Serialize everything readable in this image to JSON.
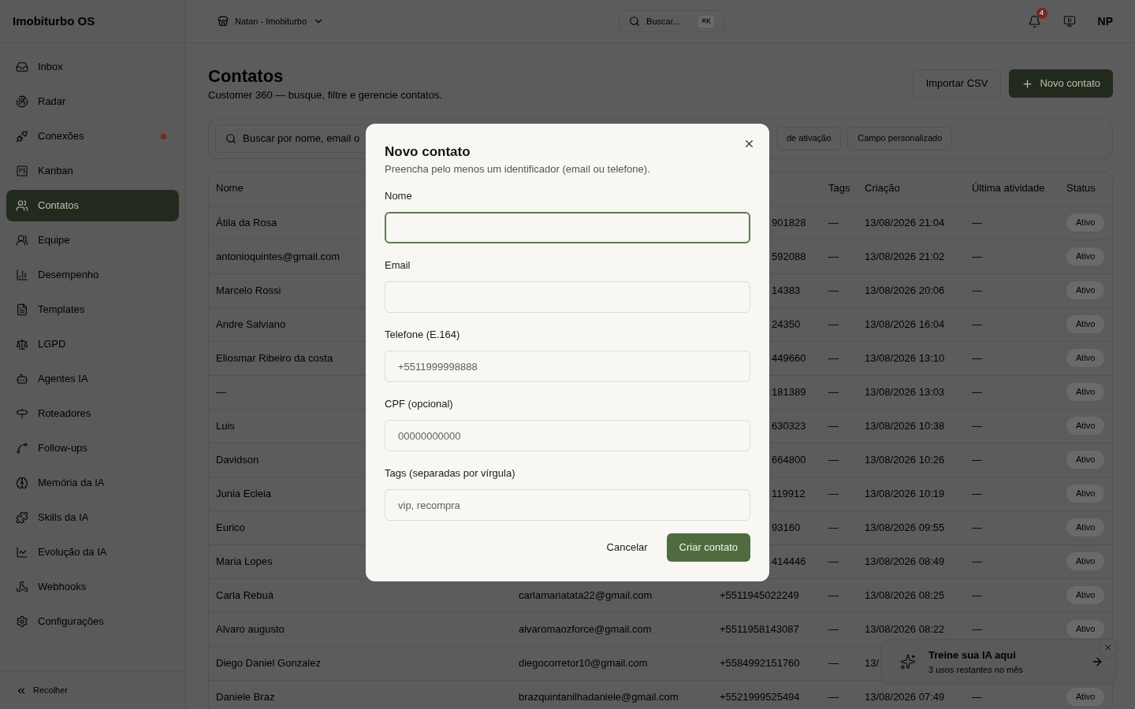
{
  "app": {
    "name": "Imobiturbo OS"
  },
  "workspace": {
    "label": "Natan - Imobiturbo"
  },
  "top_search": {
    "placeholder": "Buscar...",
    "shortcut": "⌘K"
  },
  "notifications": {
    "count": "4"
  },
  "user": {
    "initials": "NP"
  },
  "sidebar": {
    "items": [
      {
        "label": "Inbox",
        "selected": false,
        "alert": false
      },
      {
        "label": "Radar",
        "selected": false,
        "alert": false
      },
      {
        "label": "Conexões",
        "selected": false,
        "alert": true
      },
      {
        "label": "Kanban",
        "selected": false,
        "alert": false
      },
      {
        "label": "Contatos",
        "selected": true,
        "alert": false
      },
      {
        "label": "Equipe",
        "selected": false,
        "alert": false
      },
      {
        "label": "Desempenho",
        "selected": false,
        "alert": false
      },
      {
        "label": "Templates",
        "selected": false,
        "alert": false
      },
      {
        "label": "LGPD",
        "selected": false,
        "alert": false
      },
      {
        "label": "Agentes IA",
        "selected": false,
        "alert": false
      },
      {
        "label": "Roteadores",
        "selected": false,
        "alert": false
      },
      {
        "label": "Follow-ups",
        "selected": false,
        "alert": false
      },
      {
        "label": "Memória da IA",
        "selected": false,
        "alert": false
      },
      {
        "label": "Skills da IA",
        "selected": false,
        "alert": false
      },
      {
        "label": "Evolução da IA",
        "selected": false,
        "alert": false
      },
      {
        "label": "Webhooks",
        "selected": false,
        "alert": false
      },
      {
        "label": "Configurações",
        "selected": false,
        "alert": false
      }
    ],
    "collapse": "Recolher"
  },
  "page": {
    "title": "Contatos",
    "subtitle": "Customer 360 — busque, filtre e gerencie contatos.",
    "buttons": {
      "import": "Importar CSV",
      "new": "Novo contato"
    }
  },
  "filters": {
    "search_placeholder": "Buscar por nome, email o",
    "chips": [
      "de ativação",
      "Campo personalizado"
    ]
  },
  "table": {
    "header": {
      "name": "Nome",
      "tags": "Tags",
      "created": "Criação",
      "last_activity": "Última atividade",
      "status": "Status"
    },
    "rows": [
      {
        "name": "Átila da Rosa",
        "phone": "901828",
        "phone_cut": true,
        "tags": "—",
        "created": "13/08/2026 21:04",
        "last_activity": "—",
        "status": "Ativo"
      },
      {
        "name": "antonioquintes@gmail.com",
        "phone": "592088",
        "phone_cut": true,
        "tags": "—",
        "created": "13/08/2026 21:02",
        "last_activity": "—",
        "status": "Ativo"
      },
      {
        "name": "Marcelo Rossi",
        "phone": "14383",
        "phone_cut": true,
        "tags": "—",
        "created": "13/08/2026 20:06",
        "last_activity": "—",
        "status": "Ativo"
      },
      {
        "name": "Andre Salviano",
        "phone": "24350",
        "phone_cut": true,
        "tags": "—",
        "created": "13/08/2026 16:04",
        "last_activity": "—",
        "status": "Ativo"
      },
      {
        "name": "Eliosmar Ribeiro da costa",
        "phone": "449660",
        "phone_cut": true,
        "tags": "—",
        "created": "13/08/2026 13:10",
        "last_activity": "—",
        "status": "Ativo"
      },
      {
        "name": "—",
        "phone": "181389",
        "phone_cut": true,
        "tags": "—",
        "created": "13/08/2026 13:03",
        "last_activity": "—",
        "status": "Ativo"
      },
      {
        "name": "Luis",
        "phone": "630323",
        "phone_cut": true,
        "tags": "—",
        "created": "13/08/2026 10:38",
        "last_activity": "—",
        "status": "Ativo"
      },
      {
        "name": "Davidson",
        "phone": "664800",
        "phone_cut": true,
        "tags": "—",
        "created": "13/08/2026 10:26",
        "last_activity": "—",
        "status": "Ativo"
      },
      {
        "name": "Junia Ecleia",
        "phone": "119912",
        "phone_cut": true,
        "tags": "—",
        "created": "13/08/2026 10:19",
        "last_activity": "—",
        "status": "Ativo"
      },
      {
        "name": "Eurico",
        "phone": "93160",
        "phone_cut": true,
        "tags": "—",
        "created": "13/08/2026 09:55",
        "last_activity": "—",
        "status": "Ativo"
      },
      {
        "name": "Maria Lopes",
        "phone": "414446",
        "phone_cut": true,
        "tags": "—",
        "created": "13/08/2026 08:49",
        "last_activity": "—",
        "status": "Ativo"
      },
      {
        "name": "Carla Rebuá",
        "email": "carlamariatata22@gmail.com",
        "phone": "+5511945022249",
        "phone_cut": false,
        "tags": "—",
        "created": "13/08/2026 08:25",
        "last_activity": "—",
        "status": "Ativo"
      },
      {
        "name": "Alvaro augusto",
        "email": "alvaromaozforce@gmail.com",
        "phone": "+5511958143087",
        "phone_cut": false,
        "tags": "—",
        "created": "13/08/2026 08:22",
        "last_activity": "—",
        "status": "Ativo"
      },
      {
        "name": "Diego Daniel Gonzalez",
        "email": "diegocorretor10@gmail.com",
        "phone": "+5584992151760",
        "phone_cut": false,
        "tags": "—",
        "created": "13/"
      },
      {
        "name": "Daniele Braz",
        "email": "brazquintanilhadaniele@gmail.com",
        "phone": "+5521999525494",
        "phone_cut": false,
        "tags": "—",
        "created": "13/08/2026 07:49",
        "last_activity": "—",
        "status": "Ativo"
      }
    ]
  },
  "dialog": {
    "title": "Novo contato",
    "description": "Preencha pelo menos um identificador (email ou telefone).",
    "fields": [
      {
        "label": "Nome",
        "focused": true
      },
      {
        "label": "Email",
        "focused": false
      },
      {
        "label": "Telefone (E.164)",
        "placeholder": "+5511999998888",
        "focused": false
      },
      {
        "label": "CPF (opcional)",
        "placeholder": "00000000000",
        "focused": false
      },
      {
        "label": "Tags (separadas por vírgula)",
        "placeholder": "vip, recompra",
        "focused": false
      }
    ],
    "cancel": "Cancelar",
    "submit": "Criar contato"
  },
  "toast": {
    "title": "Treine sua IA aqui",
    "subtitle": "3 usos restantes no mês"
  }
}
